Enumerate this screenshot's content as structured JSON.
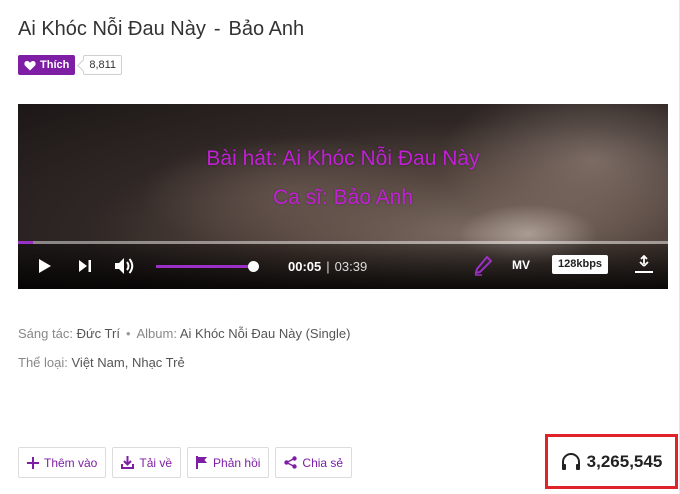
{
  "song": {
    "title": "Ai Khóc Nỗi Đau Này",
    "separator": "-",
    "artist": "Bảo Anh"
  },
  "like": {
    "label": "Thích",
    "count": "8,811",
    "color": "#7d1ea5"
  },
  "player": {
    "lyrics": [
      "Bài hát: Ai Khóc Nỗi Đau Này",
      "Ca sĩ: Bảo Anh"
    ],
    "lyric_color": "#c21fd6",
    "current_time": "00:05",
    "time_divider": "|",
    "duration": "03:39",
    "progress": 0.023,
    "volume": 0.97,
    "mv_label": "MV",
    "quality_label": "128kbps",
    "icons": [
      "play-icon",
      "next-icon",
      "volume-icon",
      "lyrics-pen-icon",
      "expand-icon"
    ]
  },
  "meta": {
    "composer_label": "Sáng tác:",
    "composer": "Đức Trí",
    "album_label": "Album:",
    "album": "Ai Khóc Nỗi Đau Này (Single)",
    "genre_label": "Thể loại:",
    "genre": "Việt Nam, Nhạc Trẻ"
  },
  "actions": [
    {
      "label": "Thêm vào",
      "icon": "plus-icon"
    },
    {
      "label": "Tải về",
      "icon": "download-icon"
    },
    {
      "label": "Phản hồi",
      "icon": "flag-icon"
    },
    {
      "label": "Chia sẻ",
      "icon": "share-icon"
    }
  ],
  "listens": {
    "count": "3,265,545",
    "icon": "headphones-icon",
    "highlight_color": "#e0222a"
  }
}
